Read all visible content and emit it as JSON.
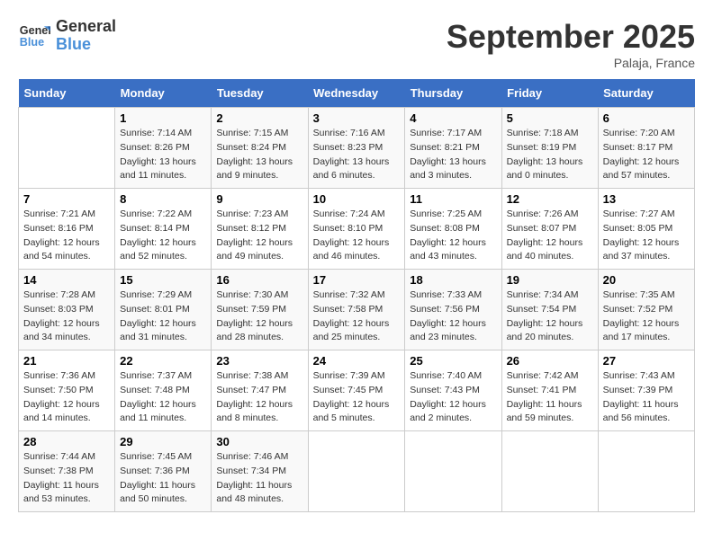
{
  "header": {
    "logo_line1": "General",
    "logo_line2": "Blue",
    "title": "September 2025",
    "location": "Palaja, France"
  },
  "days_of_week": [
    "Sunday",
    "Monday",
    "Tuesday",
    "Wednesday",
    "Thursday",
    "Friday",
    "Saturday"
  ],
  "weeks": [
    [
      {
        "day": "",
        "info": ""
      },
      {
        "day": "1",
        "info": "Sunrise: 7:14 AM\nSunset: 8:26 PM\nDaylight: 13 hours\nand 11 minutes."
      },
      {
        "day": "2",
        "info": "Sunrise: 7:15 AM\nSunset: 8:24 PM\nDaylight: 13 hours\nand 9 minutes."
      },
      {
        "day": "3",
        "info": "Sunrise: 7:16 AM\nSunset: 8:23 PM\nDaylight: 13 hours\nand 6 minutes."
      },
      {
        "day": "4",
        "info": "Sunrise: 7:17 AM\nSunset: 8:21 PM\nDaylight: 13 hours\nand 3 minutes."
      },
      {
        "day": "5",
        "info": "Sunrise: 7:18 AM\nSunset: 8:19 PM\nDaylight: 13 hours\nand 0 minutes."
      },
      {
        "day": "6",
        "info": "Sunrise: 7:20 AM\nSunset: 8:17 PM\nDaylight: 12 hours\nand 57 minutes."
      }
    ],
    [
      {
        "day": "7",
        "info": "Sunrise: 7:21 AM\nSunset: 8:16 PM\nDaylight: 12 hours\nand 54 minutes."
      },
      {
        "day": "8",
        "info": "Sunrise: 7:22 AM\nSunset: 8:14 PM\nDaylight: 12 hours\nand 52 minutes."
      },
      {
        "day": "9",
        "info": "Sunrise: 7:23 AM\nSunset: 8:12 PM\nDaylight: 12 hours\nand 49 minutes."
      },
      {
        "day": "10",
        "info": "Sunrise: 7:24 AM\nSunset: 8:10 PM\nDaylight: 12 hours\nand 46 minutes."
      },
      {
        "day": "11",
        "info": "Sunrise: 7:25 AM\nSunset: 8:08 PM\nDaylight: 12 hours\nand 43 minutes."
      },
      {
        "day": "12",
        "info": "Sunrise: 7:26 AM\nSunset: 8:07 PM\nDaylight: 12 hours\nand 40 minutes."
      },
      {
        "day": "13",
        "info": "Sunrise: 7:27 AM\nSunset: 8:05 PM\nDaylight: 12 hours\nand 37 minutes."
      }
    ],
    [
      {
        "day": "14",
        "info": "Sunrise: 7:28 AM\nSunset: 8:03 PM\nDaylight: 12 hours\nand 34 minutes."
      },
      {
        "day": "15",
        "info": "Sunrise: 7:29 AM\nSunset: 8:01 PM\nDaylight: 12 hours\nand 31 minutes."
      },
      {
        "day": "16",
        "info": "Sunrise: 7:30 AM\nSunset: 7:59 PM\nDaylight: 12 hours\nand 28 minutes."
      },
      {
        "day": "17",
        "info": "Sunrise: 7:32 AM\nSunset: 7:58 PM\nDaylight: 12 hours\nand 25 minutes."
      },
      {
        "day": "18",
        "info": "Sunrise: 7:33 AM\nSunset: 7:56 PM\nDaylight: 12 hours\nand 23 minutes."
      },
      {
        "day": "19",
        "info": "Sunrise: 7:34 AM\nSunset: 7:54 PM\nDaylight: 12 hours\nand 20 minutes."
      },
      {
        "day": "20",
        "info": "Sunrise: 7:35 AM\nSunset: 7:52 PM\nDaylight: 12 hours\nand 17 minutes."
      }
    ],
    [
      {
        "day": "21",
        "info": "Sunrise: 7:36 AM\nSunset: 7:50 PM\nDaylight: 12 hours\nand 14 minutes."
      },
      {
        "day": "22",
        "info": "Sunrise: 7:37 AM\nSunset: 7:48 PM\nDaylight: 12 hours\nand 11 minutes."
      },
      {
        "day": "23",
        "info": "Sunrise: 7:38 AM\nSunset: 7:47 PM\nDaylight: 12 hours\nand 8 minutes."
      },
      {
        "day": "24",
        "info": "Sunrise: 7:39 AM\nSunset: 7:45 PM\nDaylight: 12 hours\nand 5 minutes."
      },
      {
        "day": "25",
        "info": "Sunrise: 7:40 AM\nSunset: 7:43 PM\nDaylight: 12 hours\nand 2 minutes."
      },
      {
        "day": "26",
        "info": "Sunrise: 7:42 AM\nSunset: 7:41 PM\nDaylight: 11 hours\nand 59 minutes."
      },
      {
        "day": "27",
        "info": "Sunrise: 7:43 AM\nSunset: 7:39 PM\nDaylight: 11 hours\nand 56 minutes."
      }
    ],
    [
      {
        "day": "28",
        "info": "Sunrise: 7:44 AM\nSunset: 7:38 PM\nDaylight: 11 hours\nand 53 minutes."
      },
      {
        "day": "29",
        "info": "Sunrise: 7:45 AM\nSunset: 7:36 PM\nDaylight: 11 hours\nand 50 minutes."
      },
      {
        "day": "30",
        "info": "Sunrise: 7:46 AM\nSunset: 7:34 PM\nDaylight: 11 hours\nand 48 minutes."
      },
      {
        "day": "",
        "info": ""
      },
      {
        "day": "",
        "info": ""
      },
      {
        "day": "",
        "info": ""
      },
      {
        "day": "",
        "info": ""
      }
    ]
  ]
}
